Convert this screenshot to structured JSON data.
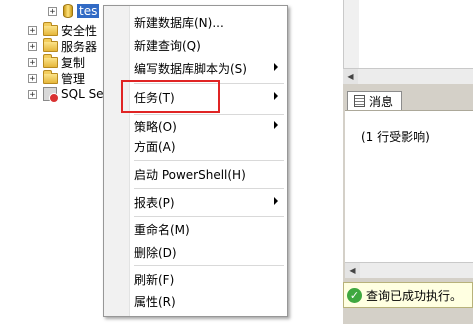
{
  "explorer": {
    "nodes": [
      {
        "label": "tes",
        "selected": true
      },
      {
        "label": "安全性"
      },
      {
        "label": "服务器"
      },
      {
        "label": "复制"
      },
      {
        "label": "管理"
      },
      {
        "label": "SQL Se"
      }
    ]
  },
  "context_menu": {
    "items": [
      {
        "label": "新建数据库(N)...",
        "submenu": false
      },
      {
        "label": "新建查询(Q)",
        "submenu": false
      },
      {
        "label": "编写数据库脚本为(S)",
        "submenu": true
      },
      {
        "label": "任务(T)",
        "submenu": true
      },
      {
        "label": "策略(O)",
        "submenu": true
      },
      {
        "label": "方面(A)",
        "submenu": false
      },
      {
        "label": "启动 PowerShell(H)",
        "submenu": false
      },
      {
        "label": "报表(P)",
        "submenu": true
      },
      {
        "label": "重命名(M)",
        "submenu": false
      },
      {
        "label": "删除(D)",
        "submenu": false
      },
      {
        "label": "刷新(F)",
        "submenu": false
      },
      {
        "label": "属性(R)",
        "submenu": false
      }
    ],
    "highlight_color": "#e02424"
  },
  "results": {
    "tab_label": "消息",
    "message": "(1 行受影响)",
    "status": "查询已成功执行。"
  }
}
